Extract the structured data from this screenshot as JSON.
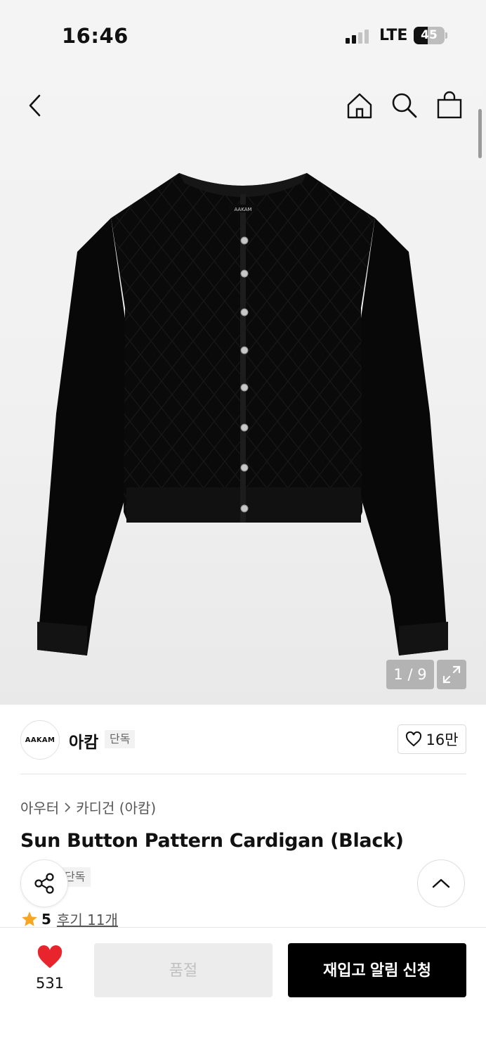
{
  "status_bar": {
    "time": "16:46",
    "network": "LTE",
    "battery": "45",
    "battery_level": 0.45
  },
  "nav": {
    "back_icon": "chevron-left-icon",
    "home_icon": "home-icon",
    "search_icon": "search-icon",
    "cart_icon": "shopping-bag-icon"
  },
  "gallery": {
    "counter": "1 / 9",
    "expand_icon": "expand-icon",
    "garment_label": "AAKAM"
  },
  "brand": {
    "logo_text": "AAKAM",
    "name": "아캄",
    "tag": "단독",
    "likes": "16만"
  },
  "breadcrumb": {
    "parent": "아우터",
    "child": "카디건 (아캄)"
  },
  "product": {
    "title": "Sun Button Pattern Cardigan (Black)",
    "tag": "단독",
    "rating": "5",
    "reviews": "후기 11개"
  },
  "bottom": {
    "wish_count": "531",
    "soldout_label": "품절",
    "restock_label": "재입고 알림 신청"
  },
  "colors": {
    "accent": "#000000",
    "heart": "#e8242d",
    "star": "#f5a623"
  }
}
